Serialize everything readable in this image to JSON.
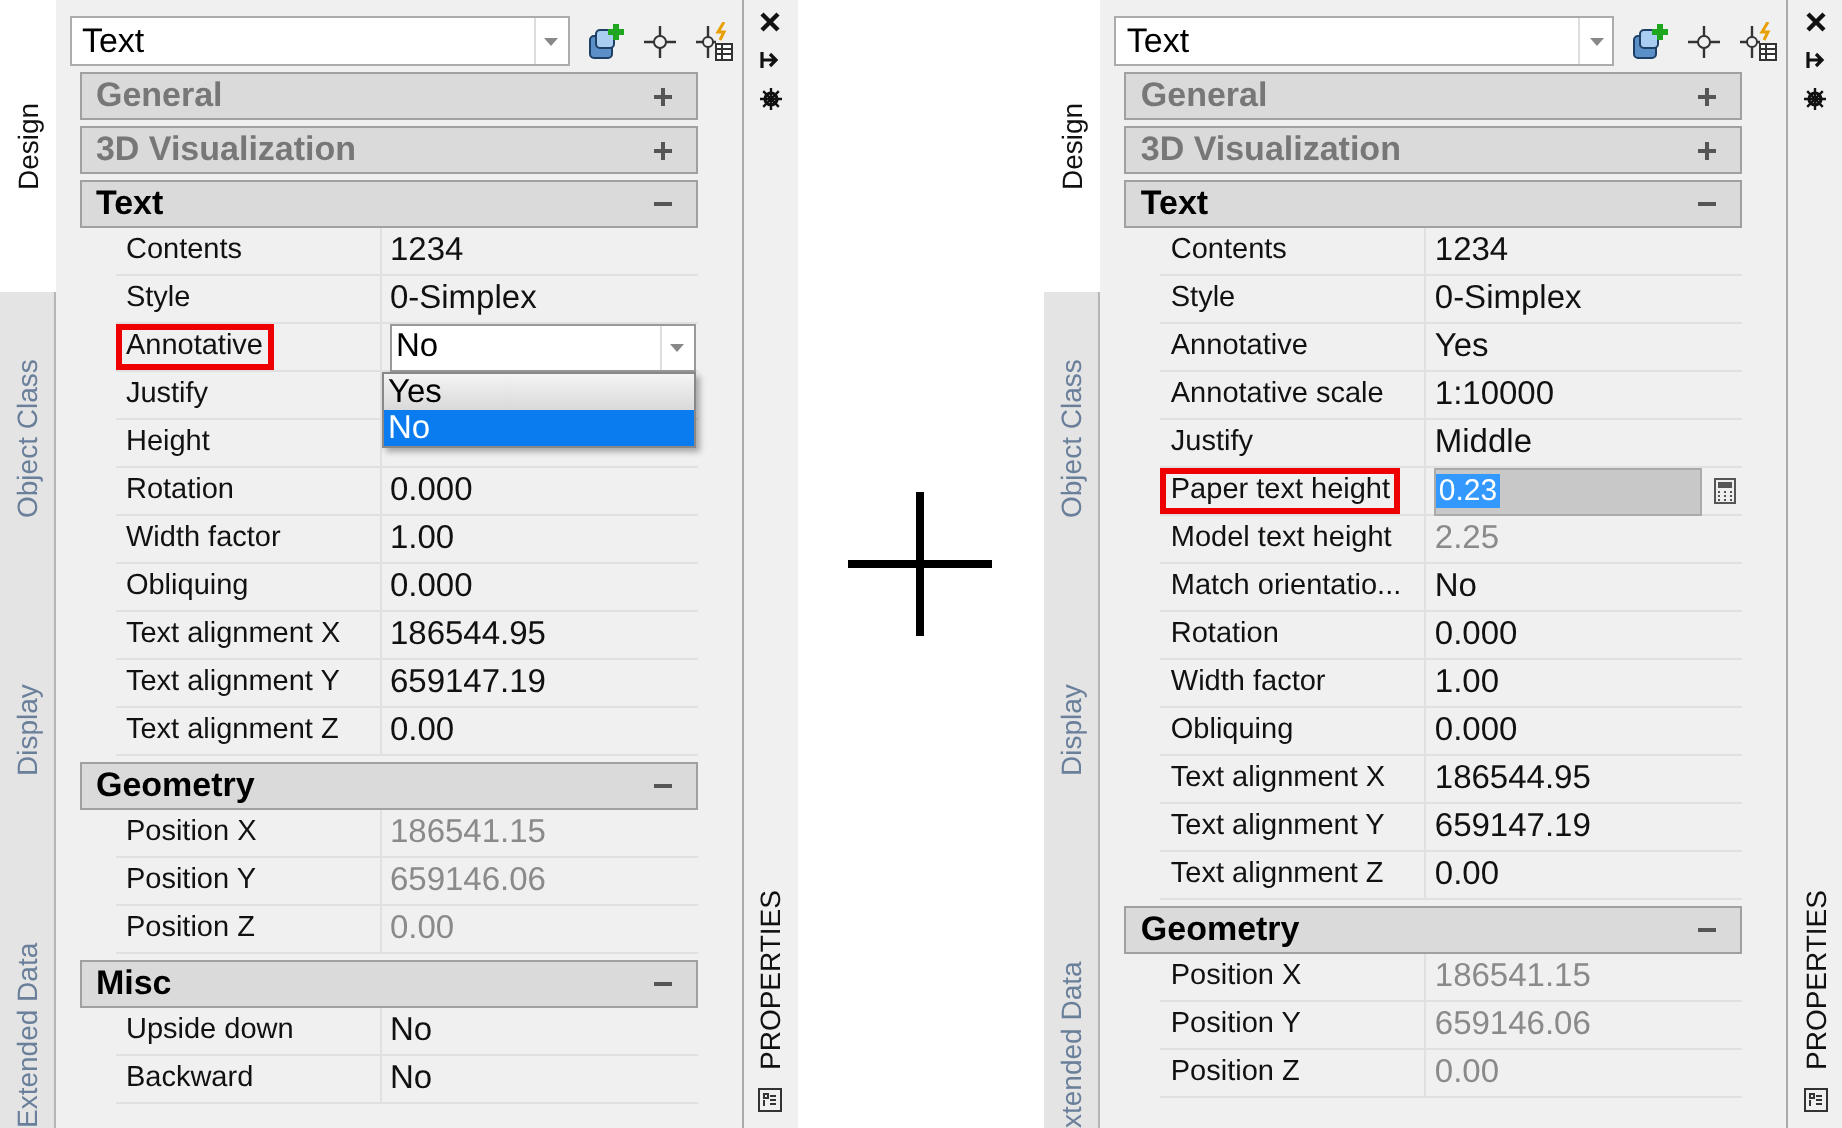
{
  "panels": [
    {
      "object_type": "Text",
      "palette_title": "PROPERTIES",
      "tabs": [
        {
          "label": "Design",
          "selected": true
        },
        {
          "label": "Object Class",
          "selected": false
        },
        {
          "label": "Display",
          "selected": false
        },
        {
          "label": "Extended Data",
          "selected": false
        }
      ],
      "sections": [
        {
          "title": "General",
          "expanded": false
        },
        {
          "title": "3D Visualization",
          "expanded": false
        },
        {
          "title": "Text",
          "expanded": true,
          "rows": [
            {
              "label": "Contents",
              "value": "1234",
              "kind": "text",
              "highlighted": false
            },
            {
              "label": "Style",
              "value": "0-Simplex",
              "kind": "text",
              "highlighted": false
            },
            {
              "label": "Annotative",
              "value": "No",
              "kind": "dropdown",
              "highlighted": true,
              "options": [
                {
                  "label": "Yes",
                  "selected": false
                },
                {
                  "label": "No",
                  "selected": true
                }
              ]
            },
            {
              "label": "Justify",
              "kind": "text",
              "highlighted": false
            },
            {
              "label": "Height",
              "kind": "text",
              "highlighted": false
            },
            {
              "label": "Rotation",
              "value": "0.000",
              "kind": "text",
              "highlighted": false
            },
            {
              "label": "Width factor",
              "value": "1.00",
              "kind": "text",
              "highlighted": false
            },
            {
              "label": "Obliquing",
              "value": "0.000",
              "kind": "text",
              "highlighted": false
            },
            {
              "label": "Text alignment X",
              "value": "186544.95",
              "kind": "text",
              "highlighted": false
            },
            {
              "label": "Text alignment Y",
              "value": "659147.19",
              "kind": "text",
              "highlighted": false
            },
            {
              "label": "Text alignment Z",
              "value": "0.00",
              "kind": "text",
              "highlighted": false
            }
          ]
        },
        {
          "title": "Geometry",
          "expanded": true,
          "rows": [
            {
              "label": "Position X",
              "value": "186541.15",
              "kind": "readonly",
              "highlighted": false
            },
            {
              "label": "Position Y",
              "value": "659146.06",
              "kind": "readonly",
              "highlighted": false
            },
            {
              "label": "Position Z",
              "value": "0.00",
              "kind": "readonly",
              "highlighted": false
            }
          ]
        },
        {
          "title": "Misc",
          "expanded": true,
          "rows": [
            {
              "label": "Upside down",
              "value": "No",
              "kind": "text",
              "highlighted": false
            },
            {
              "label": "Backward",
              "value": "No",
              "kind": "text",
              "highlighted": false
            }
          ]
        }
      ]
    },
    {
      "object_type": "Text",
      "palette_title": "PROPERTIES",
      "tabs": [
        {
          "label": "Design",
          "selected": true
        },
        {
          "label": "Object Class",
          "selected": false
        },
        {
          "label": "Display",
          "selected": false
        },
        {
          "label": "xtended Data",
          "selected": false
        }
      ],
      "sections": [
        {
          "title": "General",
          "expanded": false
        },
        {
          "title": "3D Visualization",
          "expanded": false
        },
        {
          "title": "Text",
          "expanded": true,
          "rows": [
            {
              "label": "Contents",
              "value": "1234",
              "kind": "text",
              "highlighted": false
            },
            {
              "label": "Style",
              "value": "0-Simplex",
              "kind": "text",
              "highlighted": false
            },
            {
              "label": "Annotative",
              "value": "Yes",
              "kind": "text",
              "highlighted": false
            },
            {
              "label": "Annotative scale",
              "value": "1:10000",
              "kind": "text",
              "highlighted": false
            },
            {
              "label": "Justify",
              "value": "Middle",
              "kind": "text",
              "highlighted": false
            },
            {
              "label": "Paper text height",
              "value": "0.23",
              "kind": "editing",
              "highlighted": true
            },
            {
              "label": "Model text height",
              "value": "2.25",
              "kind": "readonly",
              "highlighted": false
            },
            {
              "label": "Match orientatio...",
              "value": "No",
              "kind": "text",
              "highlighted": false
            },
            {
              "label": "Rotation",
              "value": "0.000",
              "kind": "text",
              "highlighted": false
            },
            {
              "label": "Width factor",
              "value": "1.00",
              "kind": "text",
              "highlighted": false
            },
            {
              "label": "Obliquing",
              "value": "0.000",
              "kind": "text",
              "highlighted": false
            },
            {
              "label": "Text alignment X",
              "value": "186544.95",
              "kind": "text",
              "highlighted": false
            },
            {
              "label": "Text alignment Y",
              "value": "659147.19",
              "kind": "text",
              "highlighted": false
            },
            {
              "label": "Text alignment Z",
              "value": "0.00",
              "kind": "text",
              "highlighted": false
            }
          ]
        },
        {
          "title": "Geometry",
          "expanded": true,
          "rows": [
            {
              "label": "Position X",
              "value": "186541.15",
              "kind": "readonly",
              "highlighted": false
            },
            {
              "label": "Position Y",
              "value": "659146.06",
              "kind": "readonly",
              "highlighted": false
            },
            {
              "label": "Position Z",
              "value": "0.00",
              "kind": "readonly",
              "highlighted": false
            }
          ]
        }
      ]
    }
  ]
}
